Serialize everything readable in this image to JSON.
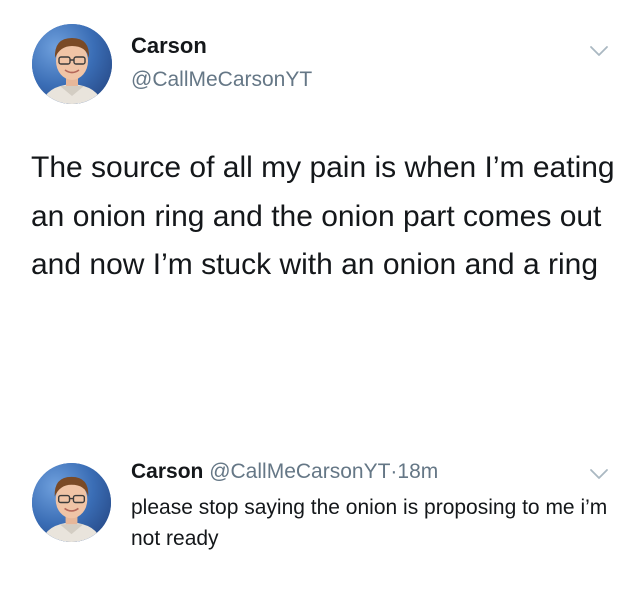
{
  "tweet": {
    "display_name": "Carson",
    "handle": "@CallMeCarsonYT",
    "text": "The source of all my pain is when I’m eating an onion ring and the onion part comes out and now I’m stuck with an onion and a ring",
    "avatar_icon": "profile-photo-icon",
    "menu_icon": "chevron-down-icon"
  },
  "reply": {
    "display_name": "Carson",
    "handle": "@CallMeCarsonYT",
    "separator": "·",
    "time": "18m",
    "text": "please stop saying the onion is proposing to me i’m not ready",
    "avatar_icon": "profile-photo-icon",
    "menu_icon": "chevron-down-icon"
  },
  "colors": {
    "text_primary": "#14171a",
    "text_secondary": "#657786",
    "chevron": "#aab8c2",
    "background": "#ffffff"
  }
}
